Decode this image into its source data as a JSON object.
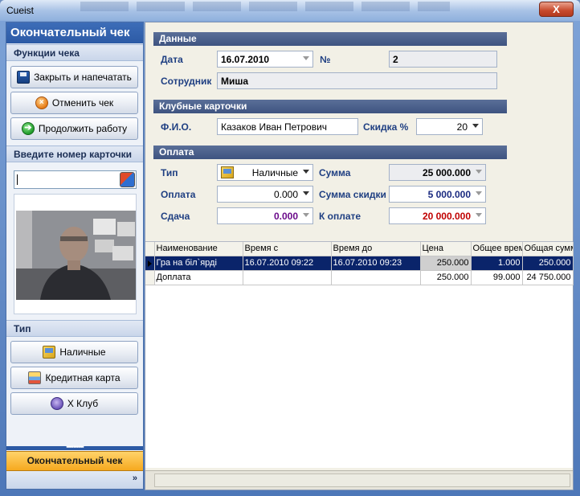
{
  "window": {
    "title": "Cueist",
    "close_label": "X"
  },
  "left_panel": {
    "header": "Окончательный чек",
    "functions_title": "Функции чека",
    "buttons": [
      {
        "label": "Закрыть и напечатать",
        "icon": "save-disk-icon"
      },
      {
        "label": "Отменить чек",
        "icon": "cancel-icon"
      },
      {
        "label": "Продолжить работу",
        "icon": "continue-icon"
      }
    ],
    "card_title": "Введите номер карточки",
    "card_input_value": "",
    "type_title": "Тип",
    "type_buttons": [
      {
        "label": "Наличные",
        "icon": "cash-icon"
      },
      {
        "label": "Кредитная карта",
        "icon": "credit-card-icon"
      },
      {
        "label": "X Клуб",
        "icon": "club-icon"
      }
    ],
    "grip": "••••••••••",
    "final_button": "Окончательный чек",
    "chevron": "»"
  },
  "main": {
    "data_section": {
      "title": "Данные",
      "date_label": "Дата",
      "date_value": "16.07.2010",
      "number_label": "№",
      "number_value": "2",
      "employee_label": "Сотрудник",
      "employee_value": "Миша"
    },
    "club_section": {
      "title": "Клубные карточки",
      "name_label": "Ф.И.О.",
      "name_value": "Казаков Иван Петрович",
      "discount_label": "Скидка %",
      "discount_value": "20"
    },
    "payment_section": {
      "title": "Оплата",
      "type_label": "Тип",
      "type_value": "Наличные",
      "sum_label": "Сумма",
      "sum_value": "25 000.000",
      "pay_label": "Оплата",
      "pay_value": "0.000",
      "discount_sum_label": "Сумма скидки",
      "discount_sum_value": "5 000.000",
      "change_label": "Сдача",
      "change_value": "0.000",
      "due_label": "К оплате",
      "due_value": "20 000.000"
    },
    "grid": {
      "columns": [
        "Наименование",
        "Время с",
        "Время до",
        "Цена",
        "Общее время",
        "Общая сумма"
      ],
      "rows": [
        [
          "Гра на біл`ярді",
          "16.07.2010 09:22",
          "16.07.2010 09:23",
          "250.000",
          "1.000",
          "250.000"
        ],
        [
          "Доплата",
          "",
          "",
          "250.000",
          "99.000",
          "24 750.000"
        ]
      ]
    }
  },
  "colors": {
    "accent_blue": "#2c5aa5",
    "section_band": "#4a5f8c",
    "final_orange": "#f6a91f",
    "selected_row": "#0a246a",
    "due_red": "#c00000",
    "change_purple": "#6a0a8a",
    "discount_navy": "#1a2a80"
  }
}
